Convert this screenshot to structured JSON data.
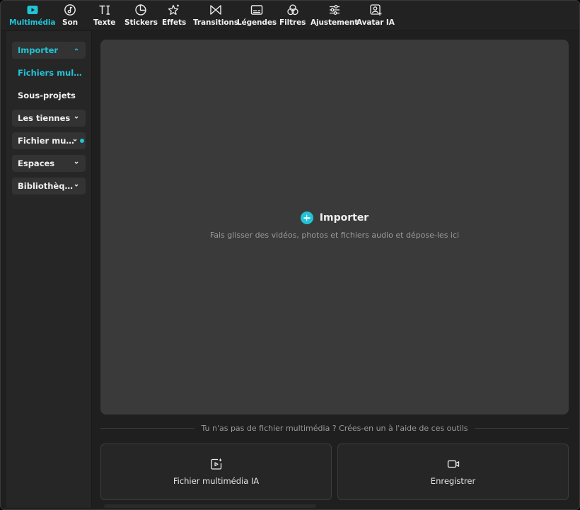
{
  "toolbar": {
    "tabs": [
      {
        "label": "Multimédia",
        "icon": "play-icon"
      },
      {
        "label": "Son",
        "icon": "music-note-icon"
      },
      {
        "label": "Texte",
        "icon": "text-icon"
      },
      {
        "label": "Stickers",
        "icon": "sticker-icon"
      },
      {
        "label": "Effets",
        "icon": "sparkle-icon"
      },
      {
        "label": "Transitions",
        "icon": "transition-icon"
      },
      {
        "label": "Légendes",
        "icon": "captions-icon"
      },
      {
        "label": "Filtres",
        "icon": "filter-icon"
      },
      {
        "label": "Ajustement",
        "icon": "sliders-icon"
      },
      {
        "label": "Avatar IA",
        "icon": "avatar-icon"
      }
    ],
    "active": "Multimédia"
  },
  "sidebar": {
    "items": [
      {
        "label": "Importer",
        "expanded": true
      },
      {
        "label": "Fichiers multimédia"
      },
      {
        "label": "Sous-projets"
      },
      {
        "label": "Les tiennes"
      },
      {
        "label": "Fichier multimédia",
        "has_dot": true
      },
      {
        "label": "Espaces"
      },
      {
        "label": "Bibliothèque"
      }
    ]
  },
  "main": {
    "import_label": "Importer",
    "drop_hint": "Fais glisser des vidéos, photos et fichiers audio et dépose-les ici",
    "divider_text": "Tu n'as pas de fichier multimédia ? Crées-en un à l'aide de ces outils",
    "cards": [
      {
        "label": "Fichier multimédia IA",
        "icon": "ai-media-icon"
      },
      {
        "label": "Enregistrer",
        "icon": "camera-icon"
      }
    ]
  },
  "colors": {
    "accent": "#22c3d6",
    "background": "#1f1f1f",
    "panel": "#3a3a3a"
  }
}
